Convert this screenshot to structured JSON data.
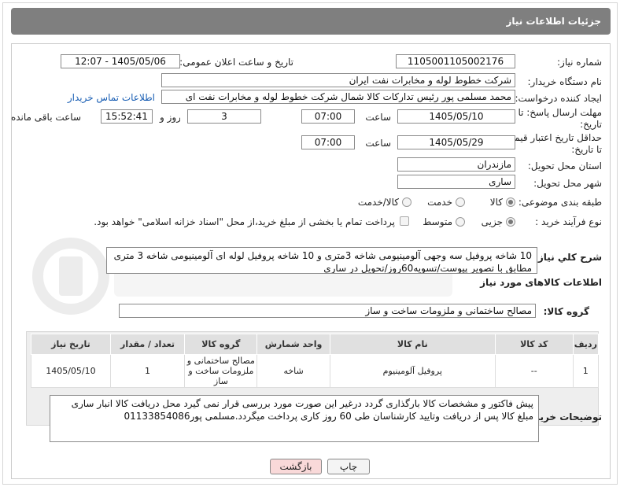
{
  "header": {
    "title": "جزئیات اطلاعات نیاز"
  },
  "form": {
    "need_number_label": "شماره نیاز:",
    "need_number": "1105001105002176",
    "announce_label": "تاریخ و ساعت اعلان عمومی:",
    "announce_value": "1405/05/06 - 12:07",
    "buyer_org_label": "نام دستگاه خریدار:",
    "buyer_org": "شرکت خطوط لوله و مخابرات نفت ایران",
    "requester_label": "ایجاد کننده درخواست:",
    "requester": "محمد مسلمی پور رئیس تدارکات کالا شمال شرکت خطوط لوله و مخابرات نفت ای",
    "contact_link": "اطلاعات تماس خریدار",
    "deadline_label_1": "مهلت ارسال پاسخ: تا",
    "deadline_label_2": "تاریخ:",
    "deadline_date": "1405/05/10",
    "time_label": "ساعت",
    "deadline_time": "07:00",
    "days_value": "3",
    "days_label": "روز و",
    "remaining_time": "15:52:41",
    "remaining_label": "ساعت باقی مانده",
    "validity_label_1": "حداقل تاریخ اعتبار قیمت:",
    "validity_label_2": "تا تاریخ:",
    "validity_date": "1405/05/29",
    "validity_time": "07:00",
    "province_label": "استان محل تحویل:",
    "province": "مازندران",
    "city_label": "شهر محل تحویل:",
    "city": "ساری",
    "category_label": "طبقه بندی موضوعی:",
    "category_options": [
      "کالا",
      "خدمت",
      "کالا/خدمت"
    ],
    "category_selected": "کالا",
    "process_label": "نوع فرآیند خرید :",
    "process_options": [
      "جزیی",
      "متوسط"
    ],
    "process_selected": "جزیی",
    "payment_note": "پرداخت تمام یا بخشی از مبلغ خرید،از محل \"اسناد خزانه اسلامی\" خواهد بود."
  },
  "description": {
    "label": "شرح کلي نياز:",
    "text": "10 شاخه پروفیل سه وجهی آلومینیومی شاخه 3متری و 10 شاخه پروفیل لوله ای آلومینیومی شاخه 3 متری مطابق با تصویر پیوست/تسویه60روز/تحویل در ساری"
  },
  "goods": {
    "section_title": "اطلاعات کالاهای مورد نیاز",
    "group_label": "گروه کالا:",
    "group_value": "مصالح ساختمانی و ملزومات ساخت و ساز",
    "columns": [
      "ردیف",
      "کد کالا",
      "نام کالا",
      "واحد شمارش",
      "گروه کالا",
      "تعداد / مقدار",
      "تاریخ نیاز"
    ],
    "rows": [
      [
        "1",
        "--",
        "پروفیل آلومینیوم",
        "شاخه",
        "مصالح ساختمانی و ملزومات ساخت و ساز",
        "1",
        "1405/05/10"
      ]
    ]
  },
  "buyer_notes": {
    "label": "توضیحات خریدار:",
    "text": "پیش فاکتور و مشخصات کالا بارگذاری گردد درغیر این صورت مورد بررسی قرار نمی گیرد محل دریافت کالا انبار ساری مبلغ کالا پس از دریافت وتایید کارشناسان طی 60 روز کاری پرداخت میگردد.مسلمی پور01133854086"
  },
  "buttons": {
    "print": "چاپ",
    "back": "بازگشت"
  },
  "colors": {
    "header_bg": "#7f7f7f",
    "link": "#1a5fb4",
    "back_bg": "#f9d9d9",
    "table_head": "#e0e0e0"
  }
}
